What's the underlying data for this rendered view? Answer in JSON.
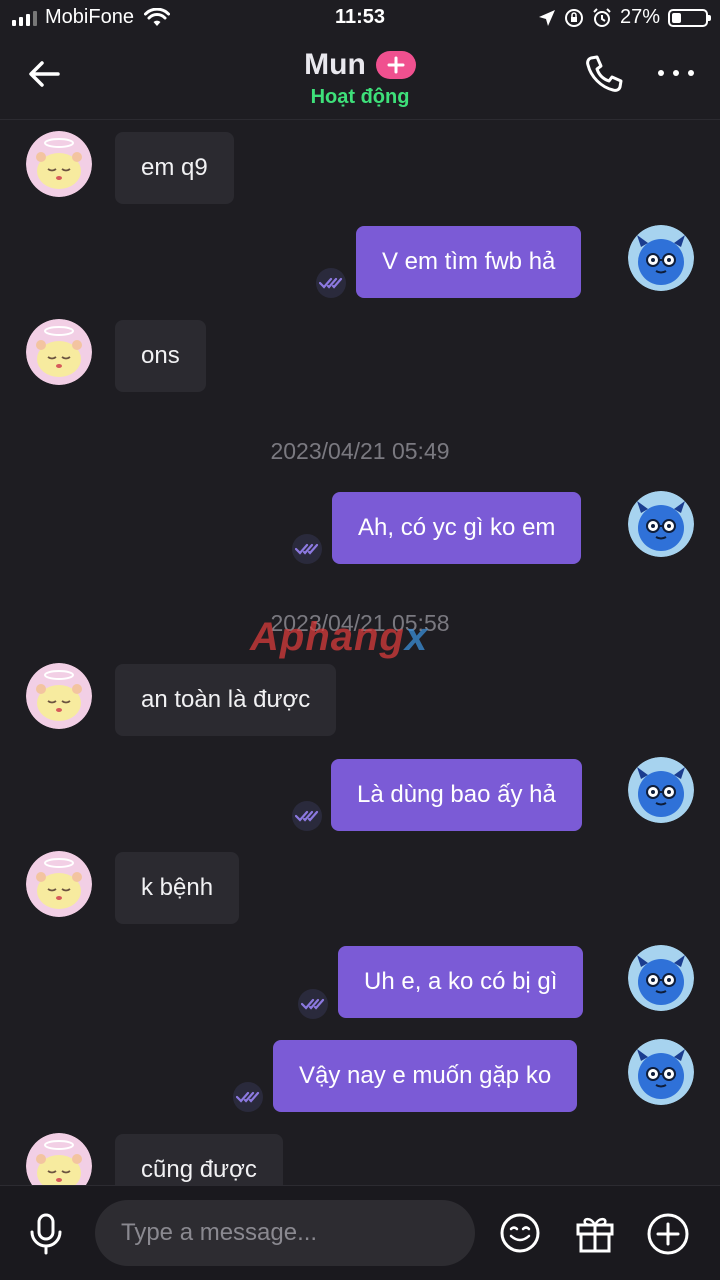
{
  "status_bar": {
    "carrier": "MobiFone",
    "time": "11:53",
    "battery": "27%",
    "battery_level": 0.27
  },
  "header": {
    "contact_name": "Mun",
    "badge": "+",
    "status": "Hoạt động"
  },
  "messages": [
    {
      "side": "in",
      "text": "em q9"
    },
    {
      "side": "out",
      "text": "V em tìm fwb hả",
      "seen": true
    },
    {
      "side": "in",
      "text": "ons"
    },
    {
      "timestamp": "2023/04/21 05:49"
    },
    {
      "side": "out",
      "text": "Ah, có yc gì ko em",
      "seen": true
    },
    {
      "timestamp": "2023/04/21 05:58"
    },
    {
      "side": "in",
      "text": "an toàn là được"
    },
    {
      "side": "out",
      "text": "Là dùng bao ấy hả",
      "seen": true
    },
    {
      "side": "in",
      "text": "k bệnh"
    },
    {
      "side": "out",
      "text": "Uh e, a ko có bị gì",
      "seen": true
    },
    {
      "side": "out",
      "text": "Vậy nay e muốn gặp ko",
      "seen": true
    },
    {
      "side": "in",
      "text": "cũng được"
    }
  ],
  "watermark": {
    "part1": "Aphang",
    "part2": "x"
  },
  "composer": {
    "placeholder": "Type a message..."
  },
  "icons": {
    "back": "arrow-left-icon",
    "call": "phone-icon",
    "more": "more-dots-icon",
    "mic": "mic-icon",
    "emoji": "emoji-icon",
    "gift": "gift-icon",
    "add": "plus-circle-icon",
    "seen": "double-check-icon"
  },
  "colors": {
    "background": "#1e1d22",
    "incoming_bubble": "#2b2a30",
    "outgoing_bubble": "#7b5bd6",
    "online_status": "#3ee07a",
    "badge": "#f0508f"
  }
}
